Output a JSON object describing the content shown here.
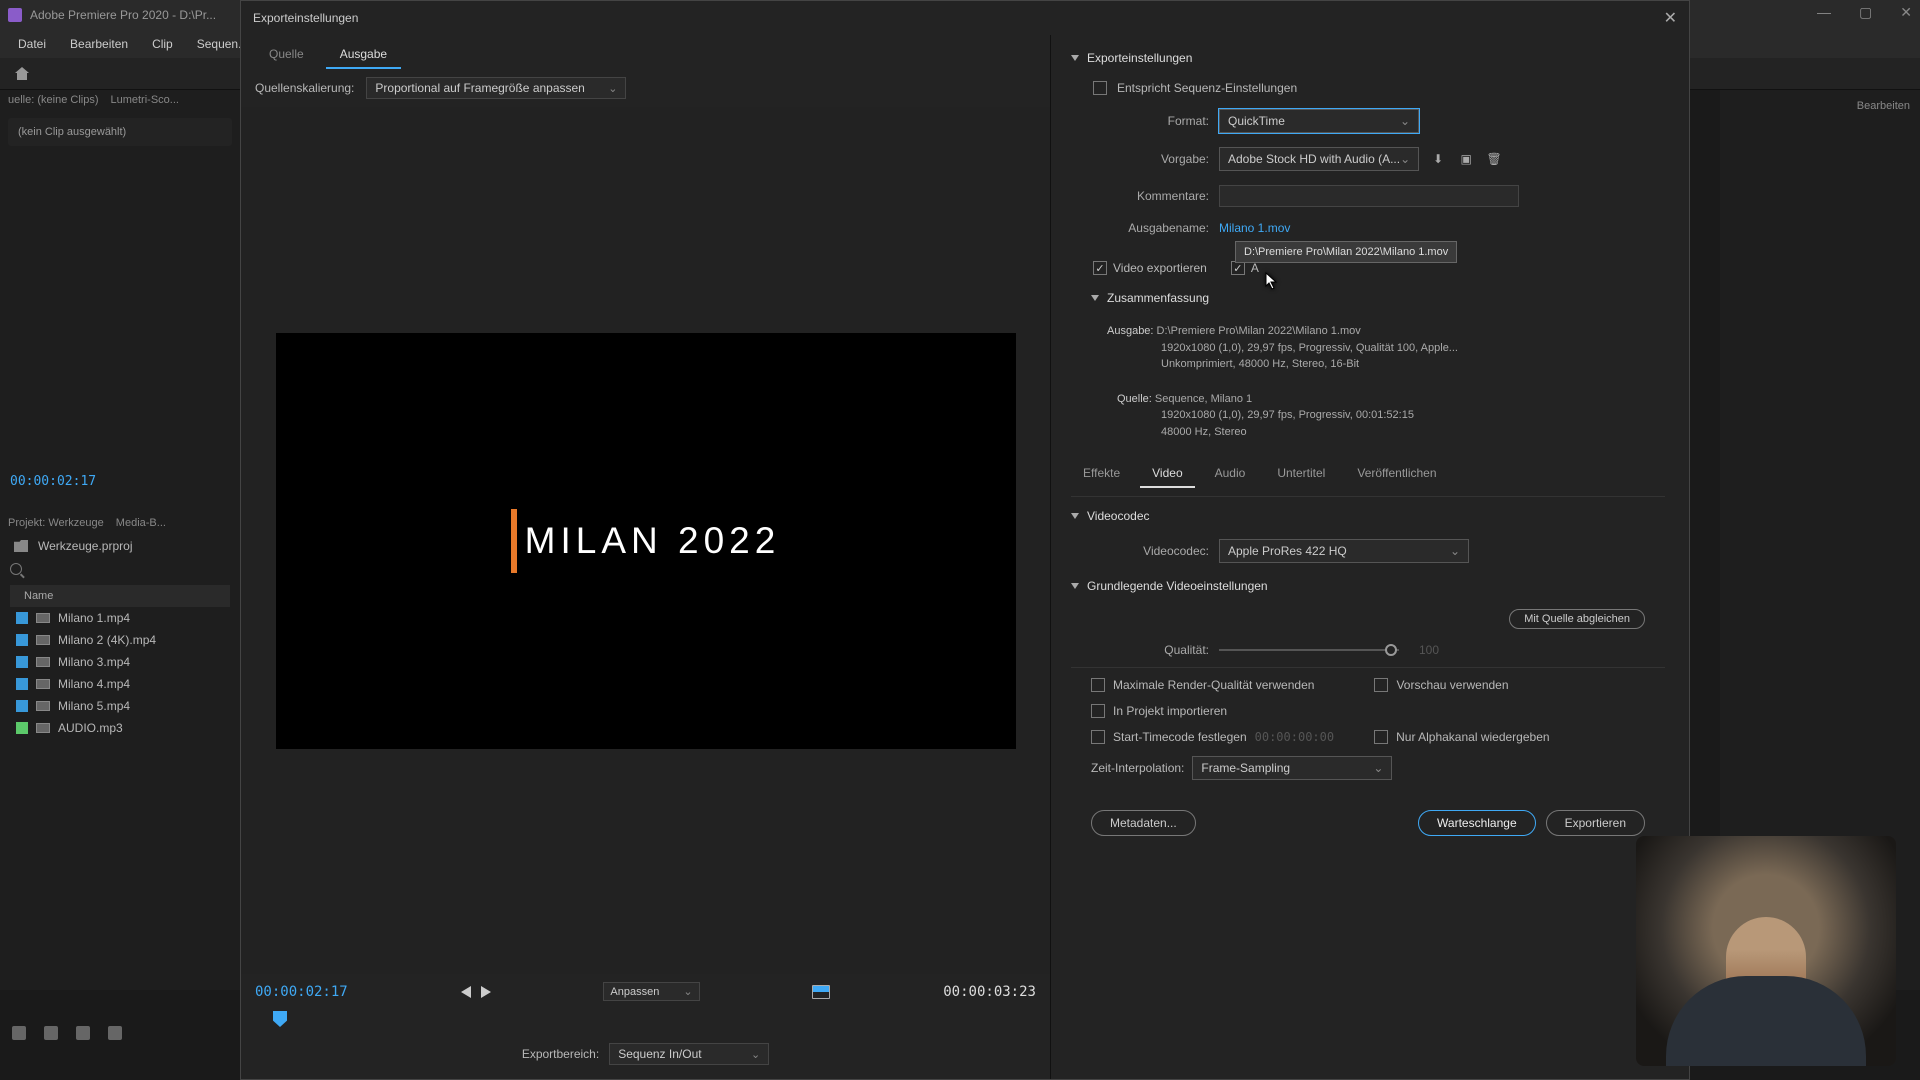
{
  "app": {
    "title": "Adobe Premiere Pro 2020 - D:\\Pr...",
    "menu": [
      "Datei",
      "Bearbeiten",
      "Clip",
      "Sequen..."
    ]
  },
  "bg": {
    "tab1": "uelle: (keine Clips)",
    "tab2": "Lumetri-Sco...",
    "no_clip": "(kein Clip ausgewählt)",
    "timecode": "00:00:02:17",
    "project_tab1": "Projekt: Werkzeuge",
    "project_tab2": "Media-B...",
    "project_name": "Werkzeuge.prproj",
    "col_name": "Name",
    "files": [
      {
        "color": "blue",
        "name": "Milano 1.mp4"
      },
      {
        "color": "blue",
        "name": "Milano 2 (4K).mp4"
      },
      {
        "color": "blue",
        "name": "Milano 3.mp4"
      },
      {
        "color": "blue",
        "name": "Milano 4.mp4"
      },
      {
        "color": "blue",
        "name": "Milano 5.mp4"
      },
      {
        "color": "green",
        "name": "AUDIO.mp3"
      }
    ],
    "right_tab": "Bearbeiten"
  },
  "dialog": {
    "title": "Exporteinstellungen",
    "tabs": {
      "source": "Quelle",
      "output": "Ausgabe"
    },
    "scale_label": "Quellenskalierung:",
    "scale_value": "Proportional auf Framegröße anpassen",
    "title_text": "Milan 2022",
    "tc_in": "00:00:02:17",
    "tc_out": "00:00:03:23",
    "fit": "Anpassen",
    "export_area_label": "Exportbereich:",
    "export_area_value": "Sequenz In/Out"
  },
  "settings": {
    "header": "Exporteinstellungen",
    "match_seq": "Entspricht Sequenz-Einstellungen",
    "format_label": "Format:",
    "format_value": "QuickTime",
    "preset_label": "Vorgabe:",
    "preset_value": "Adobe Stock HD with Audio (A...",
    "comments_label": "Kommentare:",
    "output_label": "Ausgabename:",
    "output_value": "Milano 1.mov",
    "tooltip": "D:\\Premiere Pro\\Milan 2022\\Milano 1.mov",
    "export_video": "Video exportieren",
    "export_audio": "A",
    "summary_header": "Zusammenfassung",
    "summary": {
      "out_label": "Ausgabe:",
      "out1": "D:\\Premiere Pro\\Milan 2022\\Milano 1.mov",
      "out2": "1920x1080 (1,0), 29,97 fps, Progressiv, Qualität 100, Apple...",
      "out3": "Unkomprimiert, 48000 Hz, Stereo, 16-Bit",
      "src_label": "Quelle:",
      "src1": "Sequence, Milano 1",
      "src2": "1920x1080 (1,0), 29,97 fps, Progressiv, 00:01:52:15",
      "src3": "48000 Hz, Stereo"
    },
    "tabs": [
      "Effekte",
      "Video",
      "Audio",
      "Untertitel",
      "Veröffentlichen"
    ],
    "codec_header": "Videocodec",
    "codec_label": "Videocodec:",
    "codec_value": "Apple ProRes 422 HQ",
    "basic_header": "Grundlegende Videoeinstellungen",
    "match_source": "Mit Quelle abgleichen",
    "quality_label": "Qualität:",
    "quality_value": "100"
  },
  "bottom": {
    "max_quality": "Maximale Render-Qualität verwenden",
    "preview": "Vorschau verwenden",
    "import_project": "In Projekt importieren",
    "start_tc": "Start-Timecode festlegen",
    "start_tc_val": "00:00:00:00",
    "alpha_only": "Nur Alphakanal wiedergeben",
    "interp_label": "Zeit-Interpolation:",
    "interp_value": "Frame-Sampling"
  },
  "buttons": {
    "metadata": "Metadaten...",
    "queue": "Warteschlange",
    "export": "Exportieren"
  }
}
